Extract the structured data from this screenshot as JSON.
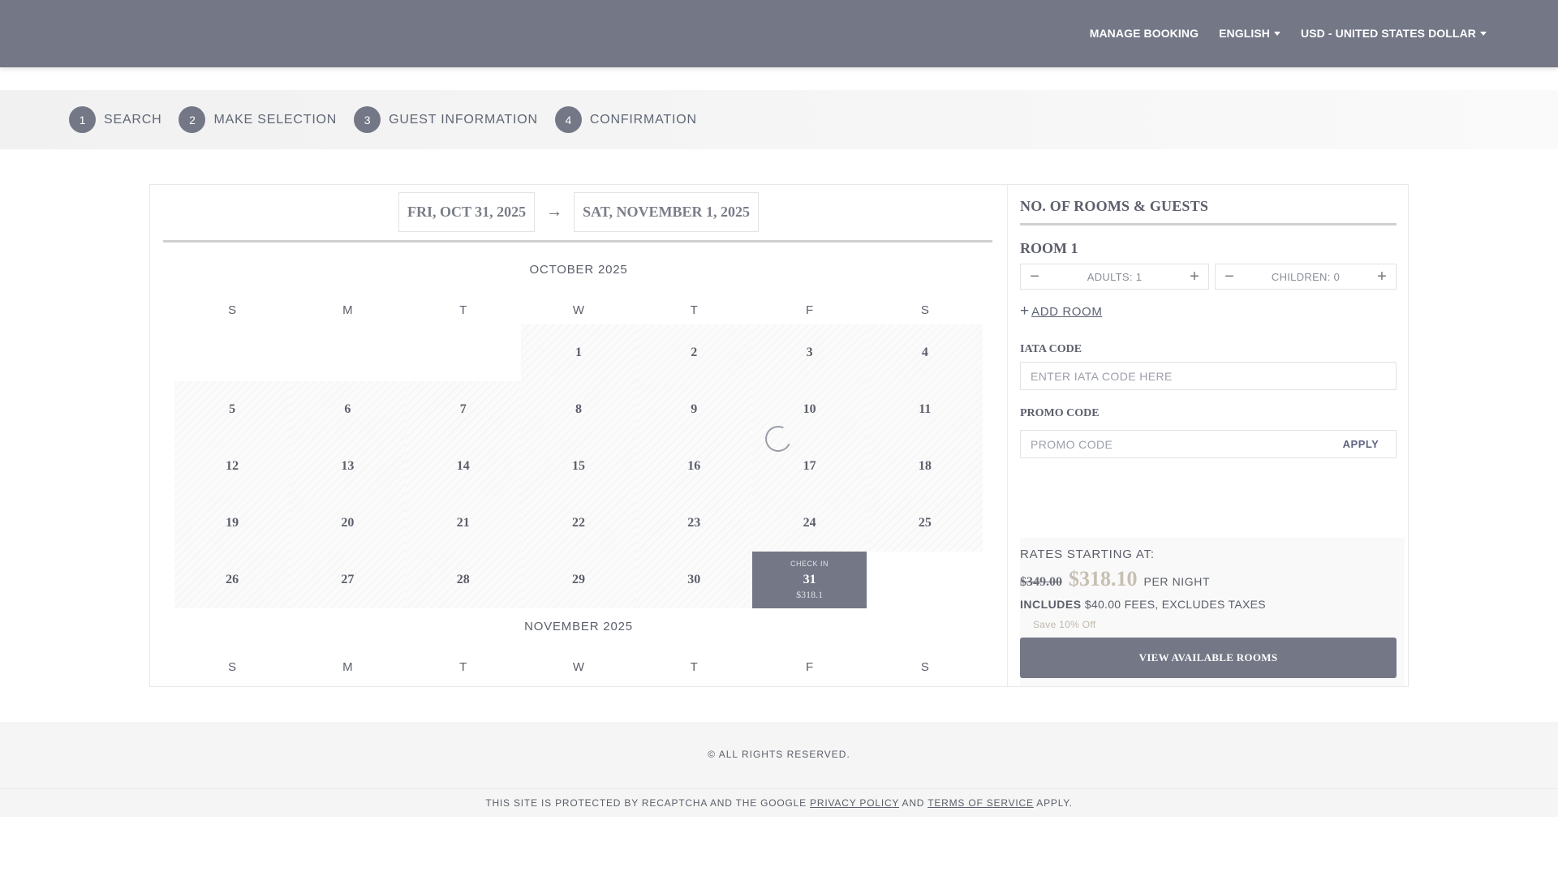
{
  "nav": {
    "manage_booking": "MANAGE BOOKING",
    "language": "ENGLISH",
    "currency": "USD - UNITED STATES DOLLAR"
  },
  "steps": [
    {
      "num": "1",
      "label": "SEARCH"
    },
    {
      "num": "2",
      "label": "MAKE SELECTION"
    },
    {
      "num": "3",
      "label": "GUEST INFORMATION"
    },
    {
      "num": "4",
      "label": "CONFIRMATION"
    }
  ],
  "dates": {
    "checkin": "FRI, OCT 31, 2025",
    "arrow": "→",
    "checkout": "SAT, NOVEMBER 1, 2025"
  },
  "calendar": {
    "month1": "OCTOBER 2025",
    "month2": "NOVEMBER 2025",
    "weekdays": [
      "S",
      "M",
      "T",
      "W",
      "T",
      "F",
      "S"
    ],
    "october_days": [
      "",
      "",
      "",
      "1",
      "2",
      "3",
      "4",
      "5",
      "6",
      "7",
      "8",
      "9",
      "10",
      "11",
      "12",
      "13",
      "14",
      "15",
      "16",
      "17",
      "18",
      "19",
      "20",
      "21",
      "22",
      "23",
      "24",
      "25",
      "26",
      "27",
      "28",
      "29",
      "30",
      "31",
      ""
    ],
    "checkin_label": "CHECK IN",
    "checkin_day": "31",
    "checkin_price": "$318.1"
  },
  "side": {
    "title": "NO. OF ROOMS & GUESTS",
    "room": "ROOM 1",
    "adults": "ADULTS: 1",
    "children": "CHILDREN: 0",
    "minus": "−",
    "plus": "+",
    "add_room": "ADD ROOM",
    "iata_label": "IATA CODE",
    "iata_placeholder": "ENTER IATA CODE HERE",
    "promo_label": "PROMO CODE",
    "promo_placeholder": "PROMO CODE",
    "apply": "APPLY"
  },
  "rates": {
    "title": "RATES STARTING AT:",
    "old_price": "$349.00",
    "new_price": "$318.10",
    "per_night": "PER NIGHT",
    "includes": "INCLUDES",
    "fees": "$40.00 FEES, EXCLUDES TAXES",
    "save": "Save 10% Off",
    "view_button": "VIEW AVAILABLE ROOMS"
  },
  "footer": {
    "rights": "© ALL RIGHTS RESERVED.",
    "recaptcha_pre": "THIS SITE IS PROTECTED BY RECAPTCHA AND THE GOOGLE",
    "privacy": "PRIVACY POLICY",
    "and": "AND",
    "terms": "TERMS OF SERVICE",
    "apply": "APPLY."
  }
}
